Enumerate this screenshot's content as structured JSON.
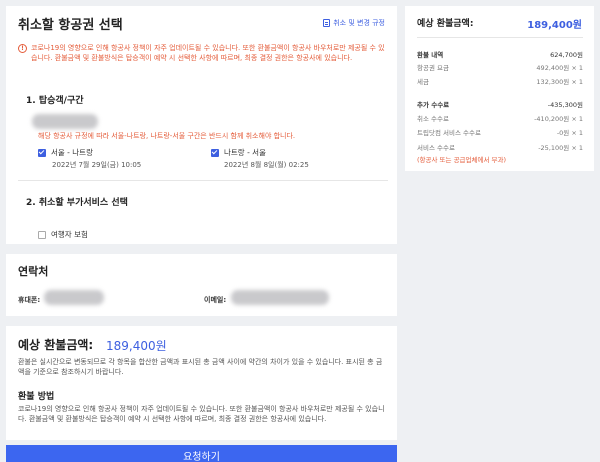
{
  "main": {
    "title": "취소할 항공권 선택",
    "policy_link": "취소 및 변경 규정",
    "notice": "코로나19의 영향으로 인해 항공사 정책이 자주 업데이트될 수 있습니다. 또한 환불금액이 항공사 바우처로만 제공될 수 있습니다. 환불금액 및 환불방식은 탑승객이 예약 시 선택한 사항에 따르며, 최종 결정 권한은 항공사에 있습니다.",
    "section1_title": "1.  탑승객/구간",
    "route_note": "해당 항공사 규정에 따라 서울-나트랑, 나트랑-서울 구간은 반드시 함께 취소해야 합니다.",
    "routes": [
      {
        "label": "서울 - 나트랑",
        "date": "2022년 7월 29일(금) 10:05"
      },
      {
        "label": "나트랑 - 서울",
        "date": "2022년 8월 8일(월) 02:25"
      }
    ],
    "section2_title": "2.  취소할 부가서비스 선택",
    "addon_label": "여행자 보험"
  },
  "contact": {
    "title": "연락처",
    "phone_label": "휴대폰:",
    "email_label": "이메일:"
  },
  "refund": {
    "title": "예상 환불금액:",
    "amount": "189,400원",
    "desc": "환불은 실시간으로 변동되므로 각 항목을 합산한 금액과 표시된 총 금액 사이에 약간의 차이가 있을 수 있습니다. 표시된 총 금액을 기준으로 참조하시기 바랍니다.",
    "method_title": "환불 방법",
    "method_desc": "코로나19의 영향으로 인해 항공사 정책이 자주 업데이트될 수 있습니다. 또한 환불금액이 항공사 바우처로만 제공될 수 있습니다. 환불금액 및 환불방식은 탑승객이 예약 시 선택한 사항에 따르며, 최종 결정 권한은 항공사에 있습니다."
  },
  "submit_label": "요청하기",
  "summary": {
    "title": "예상 환불금액:",
    "amount": "189,400원",
    "rows": [
      {
        "label": "환불 내역",
        "value": "624,700원"
      },
      {
        "label": "항공권 요금",
        "value": "492,400원 × 1"
      },
      {
        "label": "세금",
        "value": "132,300원 × 1"
      },
      {
        "label": "추가 수수료",
        "value": "-435,300원"
      },
      {
        "label": "취소 수수료",
        "value": "-410,200원 × 1"
      },
      {
        "label": "트립닷컴 서비스 수수료",
        "value": "-0원 × 1"
      },
      {
        "label": "서비스 수수료",
        "value": "-25,100원 × 1"
      }
    ],
    "note": "(항공사 또는 공급업체에서 부과)"
  },
  "colors": {
    "accent": "#3d5fe0",
    "warning": "#e45c3a",
    "button": "#3c66f0"
  }
}
